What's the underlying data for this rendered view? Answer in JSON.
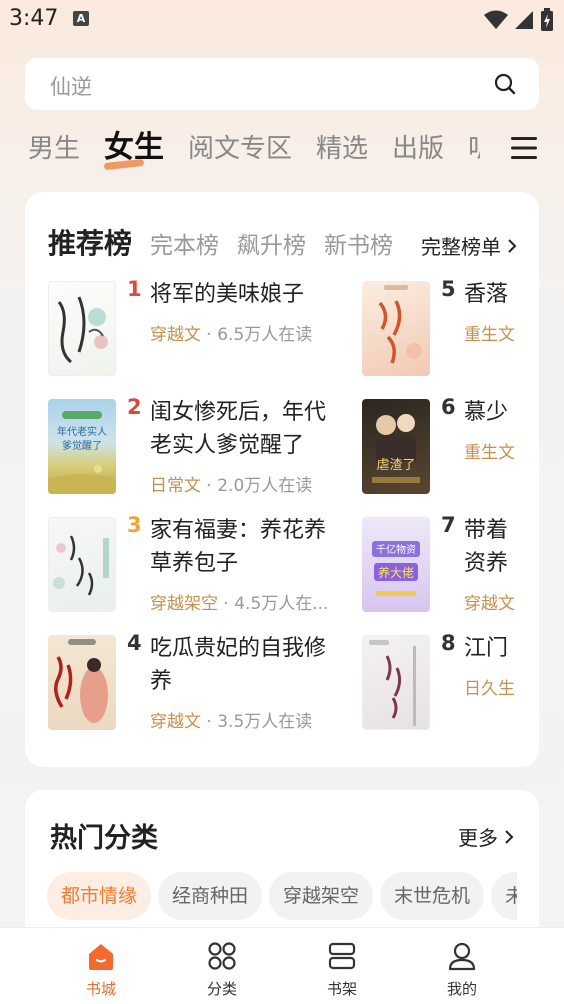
{
  "status": {
    "time": "3:47",
    "notif": "A"
  },
  "search": {
    "placeholder": "仙逆"
  },
  "tabs": [
    "男生",
    "女生",
    "阅文专区",
    "精选",
    "出版",
    "听书"
  ],
  "active_tab": 1,
  "rank": {
    "tabs": [
      "推荐榜",
      "完本榜",
      "飙升榜",
      "新书榜"
    ],
    "full_label": "完整榜单",
    "books": [
      {
        "rank": "1",
        "title": "将军的美味娘子",
        "genre": "穿越文",
        "readers": "6.5万人在读",
        "rank_color": "#e2473b"
      },
      {
        "rank": "2",
        "title": "闺女惨死后，年代老实人爹觉醒了",
        "genre": "日常文",
        "readers": "2.0万人在读",
        "rank_color": "#e2473b"
      },
      {
        "rank": "3",
        "title": "家有福妻：养花养草养包子",
        "genre": "穿越架空",
        "readers": "4.5万人在...",
        "rank_color": "#f0a534"
      },
      {
        "rank": "4",
        "title": "吃瓜贵妃的自我修养",
        "genre": "穿越文",
        "readers": "3.5万人在读",
        "rank_color": "#333333"
      },
      {
        "rank": "5",
        "title": "香落",
        "genre": "重生文",
        "readers": "",
        "rank_color": "#333333"
      },
      {
        "rank": "6",
        "title": "慕少",
        "genre": "重生文",
        "readers": "",
        "rank_color": "#333333"
      },
      {
        "rank": "7",
        "title": "带着资养大佬",
        "genre": "穿越文",
        "readers": "",
        "rank_color": "#333333"
      },
      {
        "rank": "8",
        "title": "江门",
        "genre": "日久生",
        "readers": "",
        "rank_color": "#333333"
      }
    ]
  },
  "hot": {
    "title": "热门分类",
    "more_label": "更多",
    "chips": [
      "都市情缘",
      "经商种田",
      "穿越架空",
      "末世危机",
      "未来"
    ]
  },
  "nav": [
    {
      "label": "书城",
      "icon": "home-icon"
    },
    {
      "label": "分类",
      "icon": "grid-icon"
    },
    {
      "label": "书架",
      "icon": "bookshelf-icon"
    },
    {
      "label": "我的",
      "icon": "user-icon"
    }
  ],
  "colors": {
    "accent": "#ee6a2f",
    "genre": "#c4914e"
  }
}
